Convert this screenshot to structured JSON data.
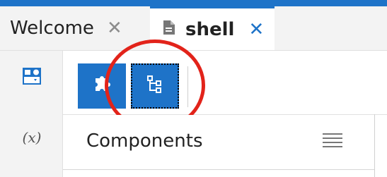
{
  "tabs": [
    {
      "label": "Welcome",
      "close": "✕"
    },
    {
      "label": "shell",
      "close": "✕"
    }
  ],
  "left_rail": {
    "icons": [
      "components-palette-icon",
      "variables-icon"
    ],
    "vars_symbol": "(x)"
  },
  "toolbar": {
    "buttons": [
      "insert-component-button",
      "tree-view-button"
    ]
  },
  "panel": {
    "title": "Components",
    "menu_icon": "hamburger-menu-icon"
  },
  "colors": {
    "accent": "#1e73c8",
    "highlight": "#e2231a",
    "chrome": "#f3f3f3"
  }
}
